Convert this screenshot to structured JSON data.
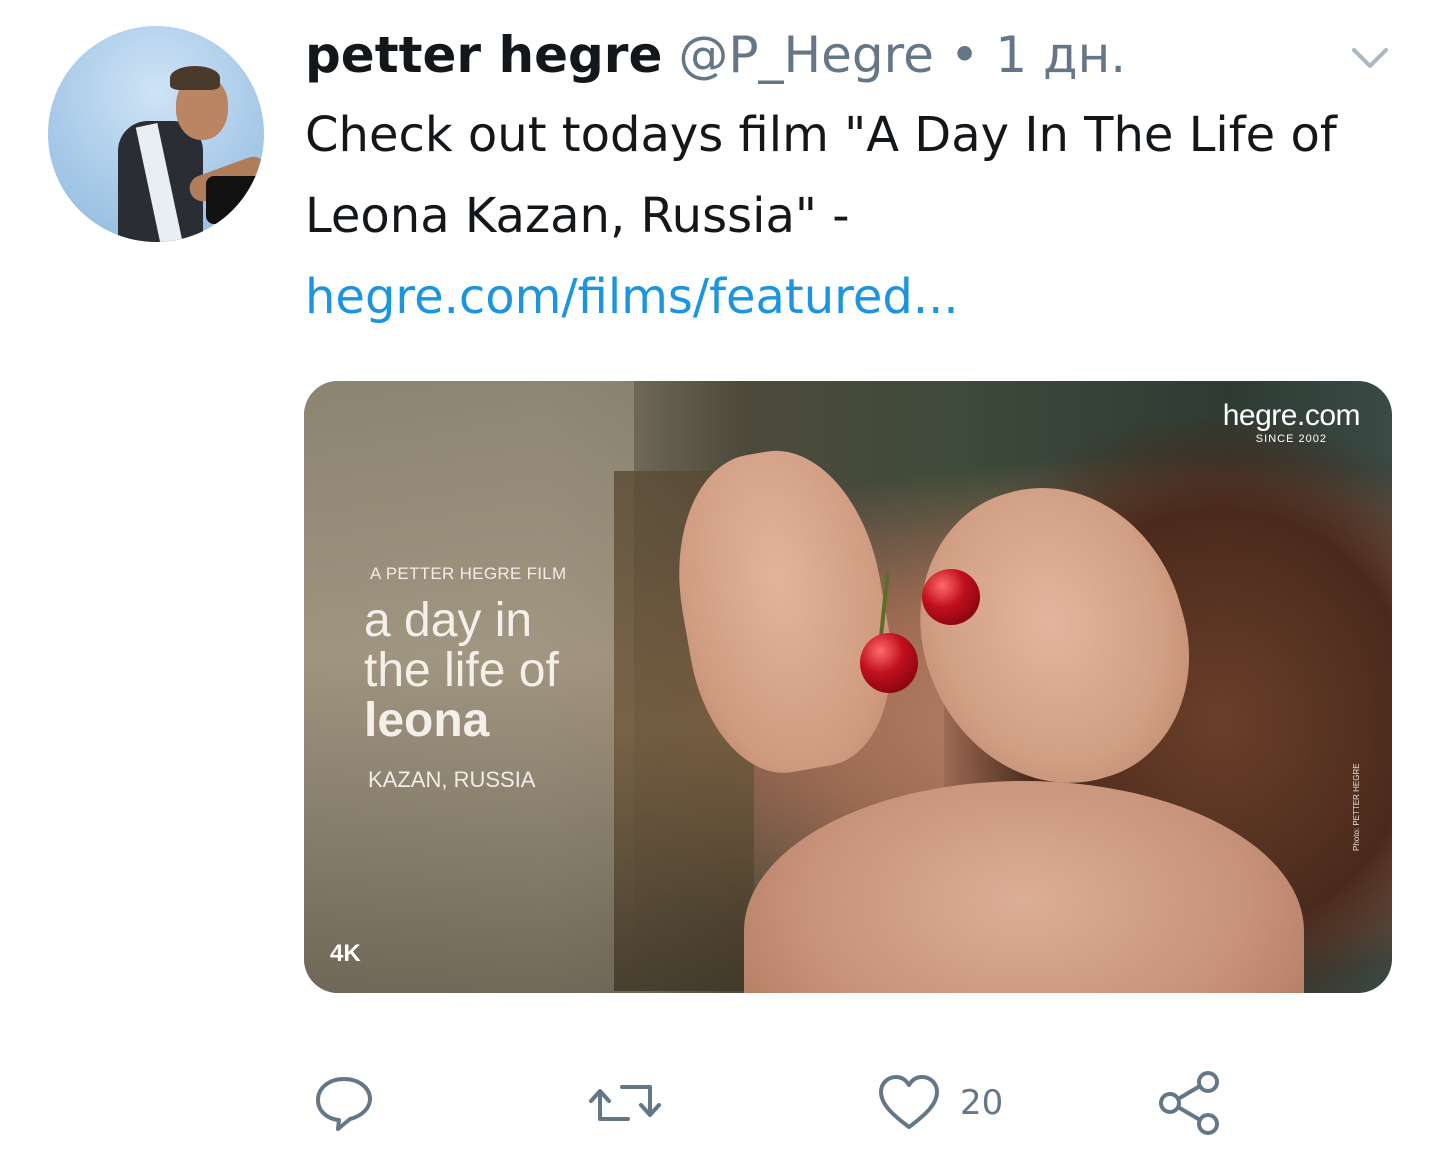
{
  "tweet": {
    "author_name": "petter hegre",
    "handle": "@P_Hegre",
    "separator": "•",
    "time": "1 дн.",
    "text": "Check out todays film \"A Day In The Life of Leona Kazan, Russia\" - ",
    "link_text": "hegre.com/films/featured..."
  },
  "media": {
    "film_credit": "A PETTER HEGRE FILM",
    "title_line_1": "a day in",
    "title_line_2": "the life of",
    "title_name": "leona",
    "location": "KAZAN, RUSSIA",
    "badge": "4K",
    "brand": "hegre.com",
    "brand_since": "SINCE 2002",
    "photo_credit": "Photo: PETTER HEGRE"
  },
  "actions": {
    "like_count": "20"
  },
  "icons": {
    "reply": "reply-icon",
    "retweet": "retweet-icon",
    "like": "heart-icon",
    "share": "share-icon",
    "menu": "chevron-down-icon"
  },
  "colors": {
    "link": "#1b95e0",
    "muted": "#657786",
    "text": "#14171a"
  }
}
